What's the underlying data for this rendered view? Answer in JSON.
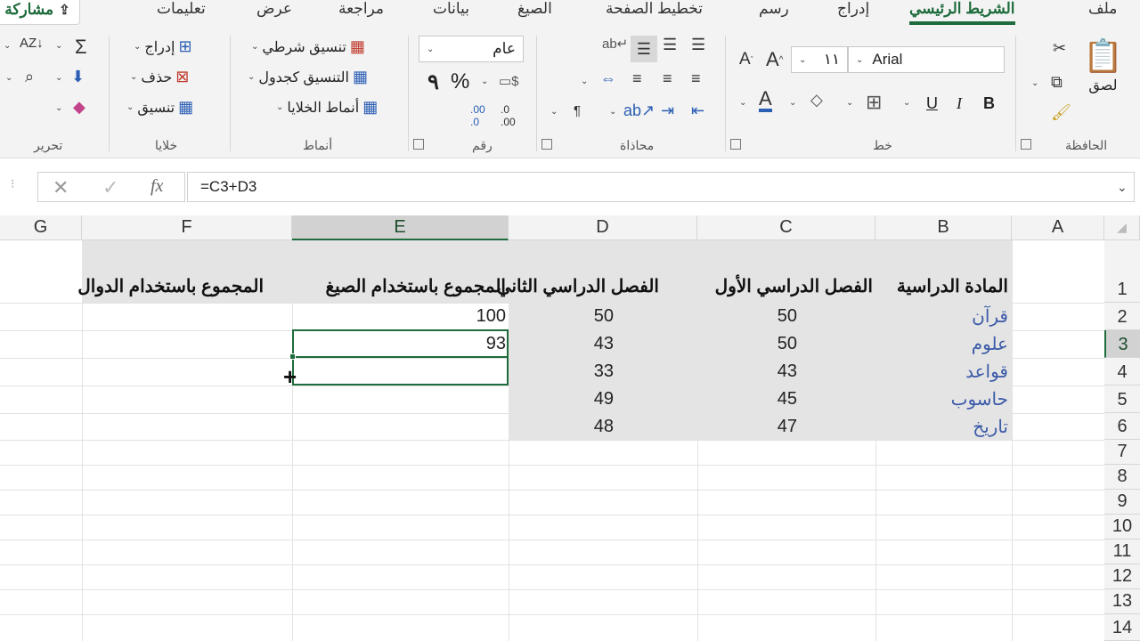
{
  "tabs": {
    "file": "ملف",
    "home": "الشريط الرئيسي",
    "insert": "إدراج",
    "draw": "رسم",
    "page_layout": "تخطيط الصفحة",
    "formulas": "الصيغ",
    "data": "بيانات",
    "review": "مراجعة",
    "view": "عرض",
    "help": "تعليمات",
    "share": "مشاركة"
  },
  "ribbon": {
    "clipboard": {
      "label": "الحافظة",
      "paste": "لصق"
    },
    "font": {
      "label": "خط",
      "name": "Arial",
      "size": "١١",
      "bold": "B",
      "italic": "I",
      "underline": "U"
    },
    "alignment": {
      "label": "محاذاة"
    },
    "number": {
      "label": "رقم",
      "format": "عام",
      "percent": "%",
      "comma": "٩"
    },
    "styles": {
      "label": "أنماط",
      "conditional": "تنسيق شرطي",
      "as_table": "التنسيق كجدول",
      "cell_styles": "أنماط الخلايا"
    },
    "cells": {
      "label": "خلايا",
      "insert": "إدراج",
      "delete": "حذف",
      "format": "تنسيق"
    },
    "editing": {
      "label": "تحرير"
    }
  },
  "formula_bar": {
    "formula": "=C3+D3",
    "fx": "fx"
  },
  "columns": [
    "A",
    "B",
    "C",
    "D",
    "E",
    "F",
    "G"
  ],
  "rows": [
    "1",
    "2",
    "3",
    "4",
    "5",
    "6",
    "7",
    "8",
    "9",
    "10",
    "11",
    "12",
    "13",
    "14"
  ],
  "sheet": {
    "headers": {
      "b1": "المادة الدراسية",
      "c1": "الفصل الدراسي الأول",
      "d1": "الفصل الدراسي الثاني",
      "e1": "المجموع باستخدام الصيغ",
      "f1": "المجموع باستخدام الدوال"
    },
    "subjects": [
      "قرآن",
      "علوم",
      "قواعد",
      "حاسوب",
      "تاريخ"
    ],
    "term1": [
      "50",
      "50",
      "43",
      "45",
      "47"
    ],
    "term2": [
      "50",
      "43",
      "33",
      "49",
      "48"
    ],
    "totals_formula": [
      "100",
      "93"
    ]
  },
  "colors": {
    "accent": "#1e6b3c",
    "subject_text": "#3b5aa8",
    "data_fill": "#e4e4e4"
  }
}
